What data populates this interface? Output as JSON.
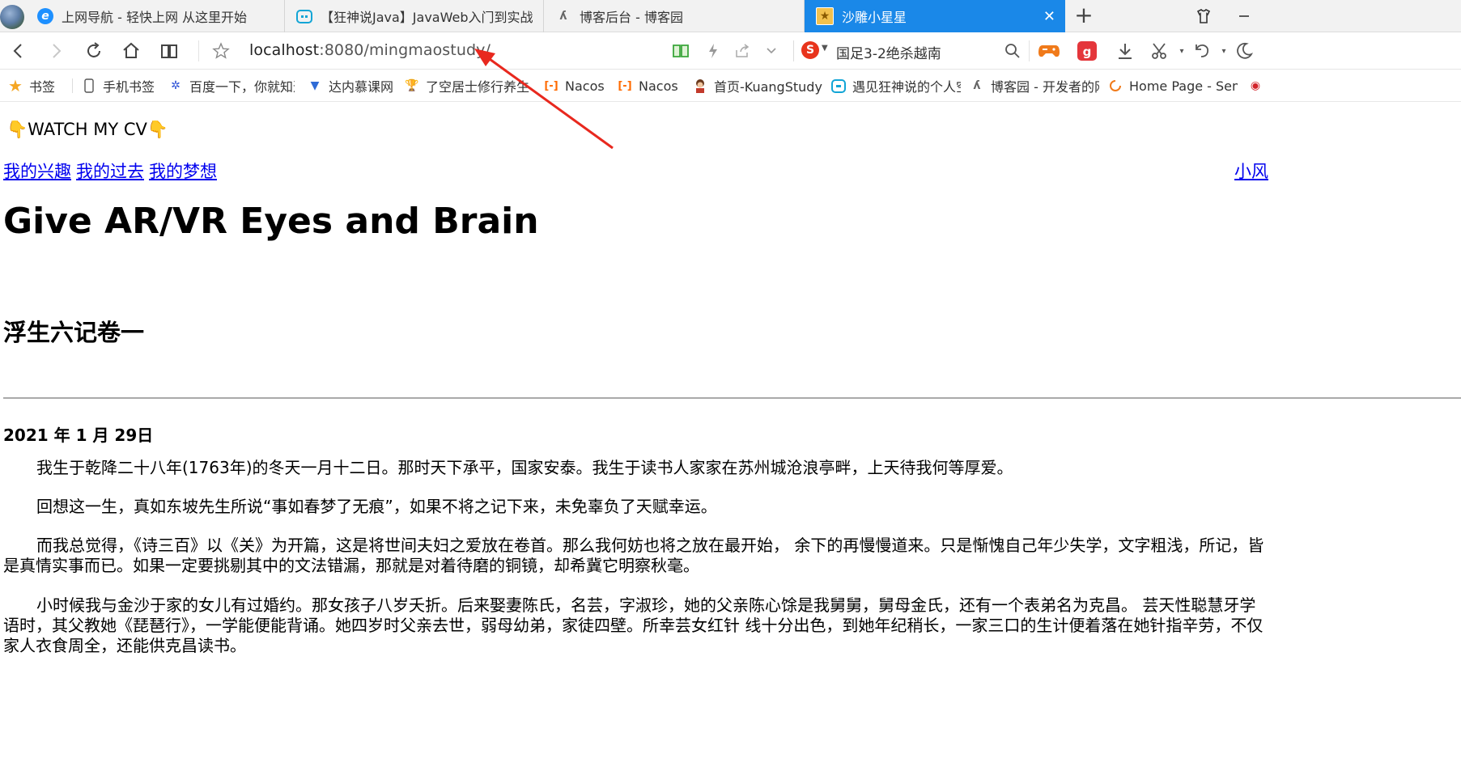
{
  "tabs": [
    {
      "label": "上网导航 - 轻快上网 从这里开始",
      "icon": "ie-icon"
    },
    {
      "label": "【狂神说Java】JavaWeb入门到实战",
      "icon": "bilibili-icon"
    },
    {
      "label": "博客后台 - 博客园",
      "icon": "cnblogs-icon"
    },
    {
      "label": "沙雕小星星",
      "icon": "favicon-icon",
      "active": true
    }
  ],
  "address": {
    "host": "localhost",
    "rest": ":8080/mingmaostudy/"
  },
  "search_suggestion": "国足3-2绝杀越南",
  "bookmarks": [
    {
      "label": "书签",
      "icon": "star-icon"
    },
    {
      "label": "手机书签",
      "icon": "phone-icon"
    },
    {
      "label": "百度一下，你就知道",
      "icon": "baidu-icon"
    },
    {
      "label": "达内慕课网",
      "icon": "tedu-icon"
    },
    {
      "label": "了空居士修行养生",
      "icon": "trophy-icon"
    },
    {
      "label": "Nacos",
      "icon": "aliyun-icon"
    },
    {
      "label": "Nacos",
      "icon": "aliyun-icon"
    },
    {
      "label": "首页-KuangStudy",
      "icon": "avatar-icon"
    },
    {
      "label": "遇见狂神说的个人空间",
      "icon": "bilibili-icon"
    },
    {
      "label": "博客园 - 开发者的网上家园",
      "icon": "cnblogs-icon"
    },
    {
      "label": "Home Page - Sem",
      "icon": "loading-icon"
    }
  ],
  "page": {
    "cv_label": "👇WATCH MY CV👇",
    "nav_links": [
      "我的兴趣",
      "我的过去",
      "我的梦想"
    ],
    "right_link": "小风",
    "hero_title": "Give AR/VR Eyes and Brain",
    "section_title": "浮生六记卷一",
    "date": "2021 年 1 月 29日",
    "paragraphs": [
      "我生于乾降二十八年(1763年)的冬天一月十二日。那时天下承平，国家安泰。我生于读书人家家在苏州城沧浪亭畔，上天待我何等厚爱。",
      "回想这一生，真如东坡先生所说“事如春梦了无痕”，如果不将之记下来，未免辜负了天赋幸运。",
      "而我总觉得，《诗三百》以《关》为开篇，这是将世间夫妇之爱放在卷首。那么我何妨也将之放在最开始， 余下的再慢慢道来。只是惭愧自己年少失学，文字粗浅，所记，皆是真情实事而已。如果一定要挑剔其中的文法错漏，那就是对着待磨的铜镜，却希冀它明察秋毫。",
      "小时候我与金沙于家的女儿有过婚约。那女孩子八岁夭折。后来娶妻陈氏，名芸，字淑珍，她的父亲陈心馀是我舅舅，舅母金氏，还有一个表弟名为克昌。 芸天性聪慧牙学语时，其父教她《琵琶行》，一学能便能背诵。她四岁时父亲去世，弱母幼弟，家徒四壁。所幸芸女红针 线十分出色，到她年纪稍长，一家三口的生计便着落在她针指辛劳，不仅家人衣食周全，还能供克昌读书。"
    ]
  },
  "colors": {
    "accent": "#1a88e8",
    "link": "#0000ee",
    "arrow": "#e8281e"
  }
}
